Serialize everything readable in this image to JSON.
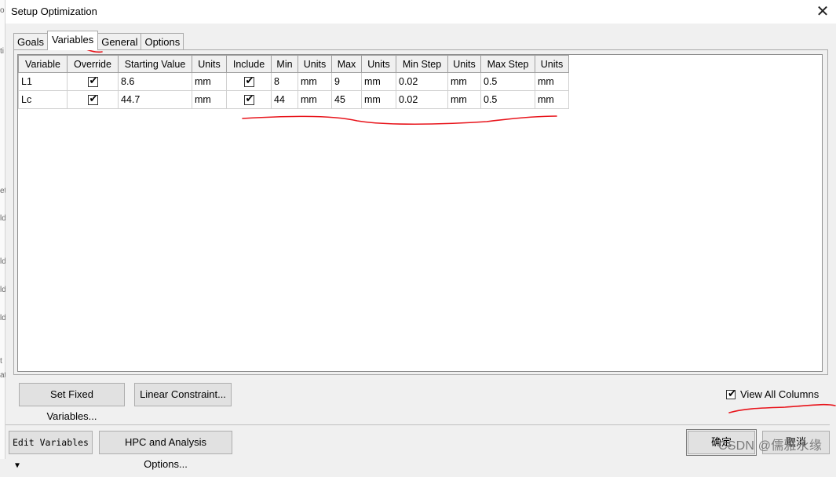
{
  "dialog": {
    "title": "Setup Optimization",
    "close_glyph": "✕"
  },
  "tabs": [
    "Goals",
    "Variables",
    "General",
    "Options"
  ],
  "active_tab": "Variables",
  "grid": {
    "columns": [
      "Variable",
      "Override",
      "Starting Value",
      "Units",
      "Include",
      "Min",
      "Units",
      "Max",
      "Units",
      "Min Step",
      "Units",
      "Max Step",
      "Units"
    ],
    "rows": [
      {
        "variable": "L1",
        "override": true,
        "starting_value": "8.6",
        "units1": "mm",
        "include": true,
        "min": "8",
        "units2": "mm",
        "max": "9",
        "units3": "mm",
        "min_step": "0.02",
        "units4": "mm",
        "max_step": "0.5",
        "units5": "mm"
      },
      {
        "variable": "Lc",
        "override": true,
        "starting_value": "44.7",
        "units1": "mm",
        "include": true,
        "min": "44",
        "units2": "mm",
        "max": "45",
        "units3": "mm",
        "min_step": "0.02",
        "units4": "mm",
        "max_step": "0.5",
        "units5": "mm"
      }
    ]
  },
  "buttons": {
    "set_fixed": "Set Fixed Variables...",
    "linear_constraint": "Linear Constraint...",
    "edit_variables": "Edit Variables",
    "hpc": "HPC and Analysis Options...",
    "ok": "确定",
    "cancel": "取消"
  },
  "view_all_columns": {
    "label": "View All Columns",
    "checked": true
  },
  "checkmark_glyph": "✔",
  "dropdown_glyph": "▼",
  "watermark": "CSDN @儒雅永缘",
  "edge_fragments": [
    "o",
    "ti",
    "et",
    "ld",
    "ld",
    "ld",
    "ld",
    "t",
    "at"
  ],
  "colors": {
    "annotation_red": "#e8141b"
  }
}
